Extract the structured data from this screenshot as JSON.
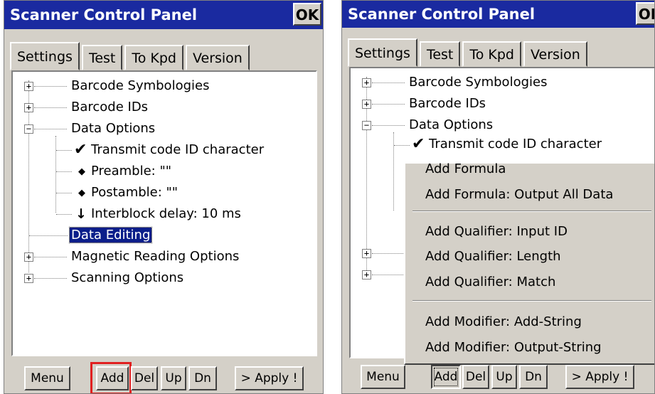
{
  "left_panel": {
    "title": "Scanner Control Panel",
    "ok_label": "OK",
    "tabs": [
      "Settings",
      "Test",
      "To Kpd",
      "Version"
    ],
    "tree": {
      "barcode_symbologies": "Barcode Symbologies",
      "barcode_ids": "Barcode IDs",
      "data_options": "Data Options",
      "transmit_code_id": "Transmit code ID character",
      "preamble": "Preamble: \"\"",
      "postamble": "Postamble: \"\"",
      "interblock_delay": "Interblock delay: 10 ms",
      "data_editing": "Data Editing",
      "magnetic_reading": "Magnetic Reading Options",
      "scanning_options": "Scanning Options"
    },
    "expander_plus": "+",
    "expander_minus": "−",
    "buttons": {
      "menu": "Menu",
      "add": "Add",
      "del": "Del",
      "up": "Up",
      "dn": "Dn",
      "apply": "> Apply !"
    },
    "highlight_color": "#e02020"
  },
  "right_panel": {
    "title": "Scanner Control Panel",
    "ok_label": "OK",
    "tabs": [
      "Settings",
      "Test",
      "To Kpd",
      "Version"
    ],
    "tree": {
      "barcode_symbologies": "Barcode Symbologies",
      "barcode_ids": "Barcode IDs",
      "data_options": "Data Options",
      "transmit_code_id": "Transmit code ID character"
    },
    "context_menu": {
      "add_formula": "Add Formula",
      "add_formula_output_all": "Add Formula: Output All Data",
      "add_qualifier_input_id": "Add Qualifier: Input ID",
      "add_qualifier_length": "Add Qualifier: Length",
      "add_qualifier_match": "Add Qualifier: Match",
      "add_modifier_add_string": "Add Modifier: Add-String",
      "add_modifier_output_string": "Add Modifier: Output-String"
    },
    "buttons": {
      "menu": "Menu",
      "add": "Add",
      "del": "Del",
      "up": "Up",
      "dn": "Dn",
      "apply": "> Apply !"
    }
  },
  "colors": {
    "titlebar": "#1a2aa0",
    "window_bg": "#d4d0c8",
    "selection": "#0a1e8a"
  }
}
